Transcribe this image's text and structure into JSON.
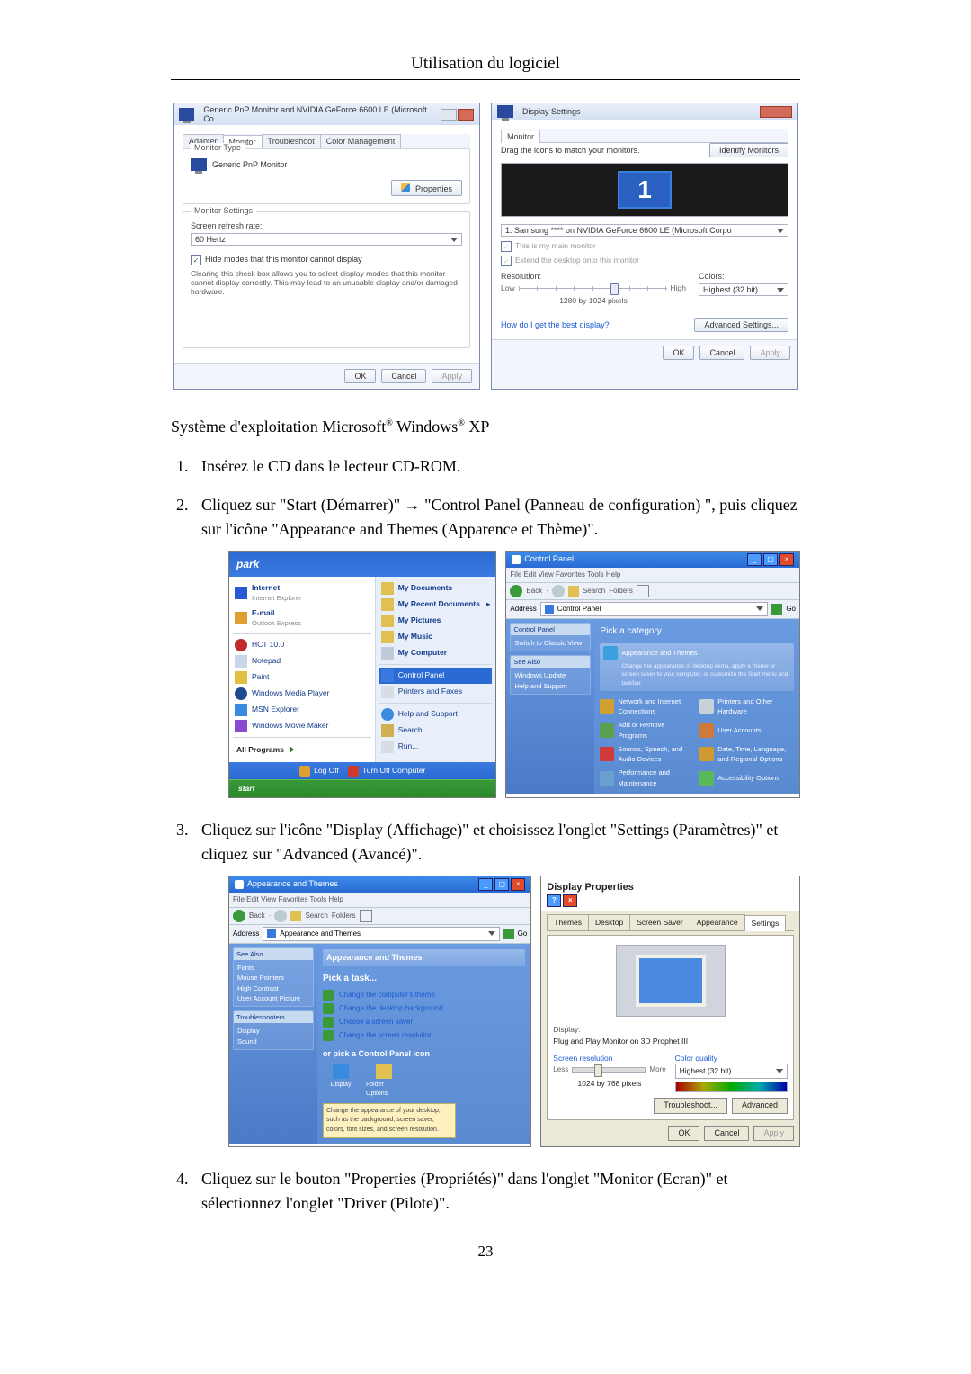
{
  "header": "Utilisation du logiciel",
  "page_no": "23",
  "vista_monitor": {
    "title": "Generic PnP Monitor and NVIDIA GeForce 6600 LE (Microsoft Co...",
    "tabs": [
      "Adapter",
      "Monitor",
      "Troubleshoot",
      "Color Management"
    ],
    "active_tab": 1,
    "monitor_type_legend": "Monitor Type",
    "monitor_name": "Generic PnP Monitor",
    "properties_btn": "Properties",
    "settings_legend": "Monitor Settings",
    "refresh_label": "Screen refresh rate:",
    "refresh_value": "60 Hertz",
    "hide_modes": "Hide modes that this monitor cannot display",
    "hide_note": "Clearing this check box allows you to select display modes that this monitor cannot display correctly. This may lead to an unusable display and/or damaged hardware.",
    "ok": "OK",
    "cancel": "Cancel",
    "apply": "Apply"
  },
  "vista_display": {
    "title": "Display Settings",
    "tab": "Monitor",
    "drag_text": "Drag the icons to match your monitors.",
    "identify_btn": "Identify Monitors",
    "mon_number": "1",
    "monitor_select": "1. Samsung **** on NVIDIA GeForce 6600 LE (Microsoft Corpo",
    "chk_main": "This is my main monitor",
    "chk_extend": "Extend the desktop onto this monitor",
    "resolution_lbl": "Resolution:",
    "low": "Low",
    "high": "High",
    "res_value": "1280 by 1024 pixels",
    "colors_lbl": "Colors:",
    "colors_value": "Highest (32 bit)",
    "best_link": "How do I get the best display?",
    "advanced_btn": "Advanced Settings...",
    "ok": "OK",
    "cancel": "Cancel",
    "apply": "Apply"
  },
  "os_line": {
    "pre": "Système d'exploitation Microsoft",
    "mid": " Windows",
    "post": " XP"
  },
  "step1": "Insérez le CD dans le lecteur CD-ROM.",
  "step2": "Cliquez sur \"Start (Démarrer)\" → \"Control Panel (Panneau de configuration) \", puis cliquez sur l'icône \"Appearance and Themes (Apparence et Thème)\".",
  "step3": "Cliquez sur l'icône \"Display (Affichage)\" et choisissez l'onglet \"Settings (Paramètres)\" et cliquez sur \"Advanced (Avancé)\".",
  "step4": "Cliquez sur le bouton \"Properties (Propriétés)\" dans l'onglet \"Monitor (Ecran)\" et sélectionnez l'onglet \"Driver (Pilote)\".",
  "startmenu": {
    "user": "park",
    "left": {
      "internet": "Internet",
      "internet_sub": "Internet Explorer",
      "email": "E-mail",
      "email_sub": "Outlook Express",
      "hct": "HCT 10.0",
      "notepad": "Notepad",
      "paint": "Paint",
      "wmp": "Windows Media Player",
      "msn": "MSN Explorer",
      "wmm": "Windows Movie Maker",
      "allprog": "All Programs"
    },
    "right": {
      "mydocs": "My Documents",
      "recent": "My Recent Documents",
      "pictures": "My Pictures",
      "music": "My Music",
      "mycomp": "My Computer",
      "cpanel": "Control Panel",
      "printers": "Printers and Faxes",
      "help": "Help and Support",
      "search": "Search",
      "run": "Run..."
    },
    "logoff": "Log Off",
    "turnoff": "Turn Off Computer",
    "start": "start"
  },
  "cp_main": {
    "title": "Control Panel",
    "menu": "File  Edit  View  Favorites  Tools  Help",
    "back": "Back",
    "search": "Search",
    "folders": "Folders",
    "addr": "Control Panel",
    "go": "Go",
    "side_switch": "Switch to Classic View",
    "see_also": "See Also",
    "win_update": "Windows Update",
    "help": "Help and Support",
    "pick": "Pick a category",
    "cats": {
      "appearance": "Appearance and Themes",
      "printers": "Printers and Other Hardware",
      "network": "Network and Internet Connections",
      "users": "User Accounts",
      "addremove": "Add or Remove Programs",
      "dtlr": "Date, Time, Language, and Regional Options",
      "sounds": "Sounds, Speech, and Audio Devices",
      "access": "Accessibility Options",
      "perf": "Performance and Maintenance"
    },
    "tooltip": "Change the appearance of desktop items, apply a theme or screen saver to your computer, or customize the Start menu and taskbar."
  },
  "cp_appearance": {
    "title": "Appearance and Themes",
    "menu": "File  Edit  View  Favorites  Tools  Help",
    "addr": "Appearance and Themes",
    "see_also": "See Also",
    "fonts": "Fonts",
    "mouse": "Mouse Pointers",
    "hc": "High Contrast",
    "ua": "User Account Picture",
    "troubleshoot": "Troubleshooters",
    "disp": "Display",
    "sound": "Sound",
    "heading": "Appearance and Themes",
    "pick_task": "Pick a task...",
    "t1": "Change the computer's theme",
    "t2": "Change the desktop background",
    "t3": "Choose a screen saver",
    "t4": "Change the screen resolution",
    "or_pick": "or pick a Control Panel icon",
    "ico_display": "Display",
    "ico_folder": "Folder Options",
    "tooltip": "Change the appearance of your desktop, such as the background, screen saver, colors, font sizes, and screen resolution."
  },
  "display_props": {
    "title": "Display Properties",
    "tabs": [
      "Themes",
      "Desktop",
      "Screen Saver",
      "Appearance",
      "Settings"
    ],
    "active_tab": 4,
    "display_lbl": "Display:",
    "display_name": "Plug and Play Monitor on 3D Prophet III",
    "screenres": "Screen resolution",
    "less": "Less",
    "more": "More",
    "resval": "1024 by 768 pixels",
    "colorq": "Color quality",
    "colorv": "Highest (32 bit)",
    "troubleshoot_btn": "Troubleshoot...",
    "advanced_btn": "Advanced",
    "ok": "OK",
    "cancel": "Cancel",
    "apply": "Apply"
  }
}
